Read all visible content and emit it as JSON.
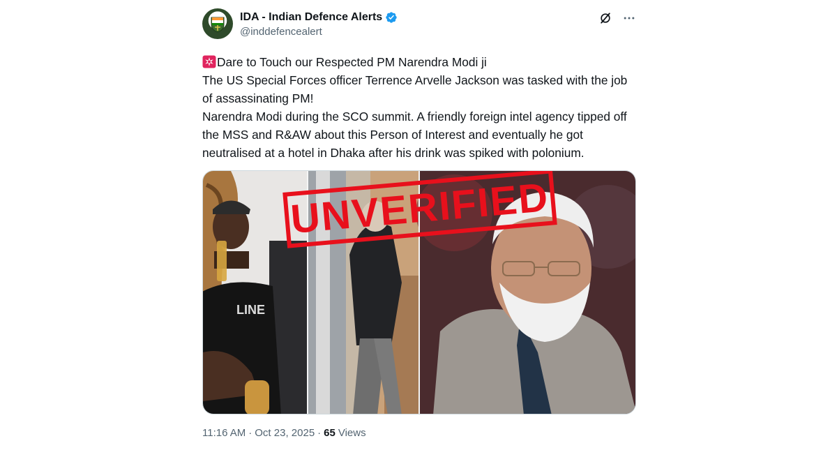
{
  "author": {
    "display_name": "IDA - Indian Defence Alerts",
    "handle": "@inddefencealert",
    "verified": true
  },
  "post": {
    "lines": [
      "Dare to Touch our Respected PM Narendra Modi ji",
      "The US Special Forces officer Terrence Arvelle Jackson was tasked with the job of assassinating PM!",
      "Narendra Modi during the SCO summit. A friendly foreign intel agency tipped off the MSS and R&AW about this Person of Interest and eventually he got neutralised at a hotel in Dhaka after his drink was spiked with polonium."
    ],
    "leading_emoji": "police-siren-icon"
  },
  "media": {
    "stamp_text": "UNVERIFIED",
    "stamp_color": "#e8101c"
  },
  "meta": {
    "time": "11:16 AM",
    "separator": "·",
    "date": "Oct 23, 2025",
    "views_count": "65",
    "views_label": "Views"
  },
  "colors": {
    "text_primary": "#0f1419",
    "text_secondary": "#536471",
    "verified_blue": "#1d9bf0",
    "border": "#cfd9de"
  },
  "icons": {
    "verified": "verified-badge-icon",
    "grok": "grok-icon",
    "more": "more-options-icon"
  }
}
